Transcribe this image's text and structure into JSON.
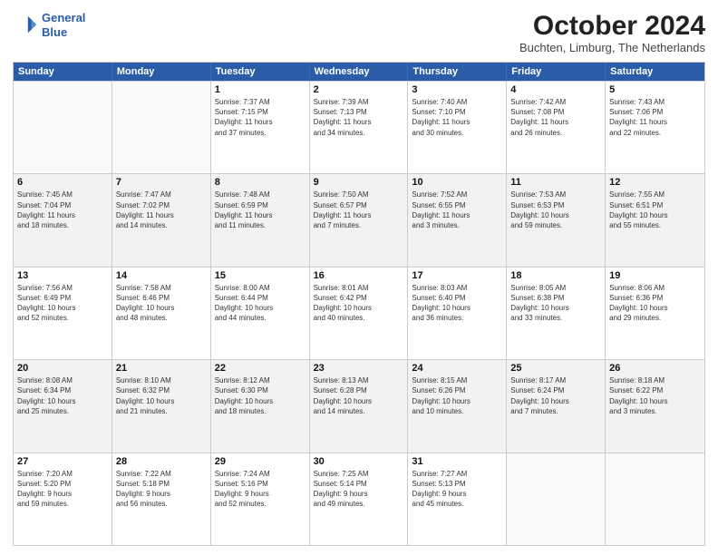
{
  "logo": {
    "line1": "General",
    "line2": "Blue"
  },
  "title": "October 2024",
  "subtitle": "Buchten, Limburg, The Netherlands",
  "days_of_week": [
    "Sunday",
    "Monday",
    "Tuesday",
    "Wednesday",
    "Thursday",
    "Friday",
    "Saturday"
  ],
  "weeks": [
    [
      {
        "day": "",
        "info": "",
        "empty": true
      },
      {
        "day": "",
        "info": "",
        "empty": true
      },
      {
        "day": "1",
        "info": "Sunrise: 7:37 AM\nSunset: 7:15 PM\nDaylight: 11 hours\nand 37 minutes.",
        "empty": false
      },
      {
        "day": "2",
        "info": "Sunrise: 7:39 AM\nSunset: 7:13 PM\nDaylight: 11 hours\nand 34 minutes.",
        "empty": false
      },
      {
        "day": "3",
        "info": "Sunrise: 7:40 AM\nSunset: 7:10 PM\nDaylight: 11 hours\nand 30 minutes.",
        "empty": false
      },
      {
        "day": "4",
        "info": "Sunrise: 7:42 AM\nSunset: 7:08 PM\nDaylight: 11 hours\nand 26 minutes.",
        "empty": false
      },
      {
        "day": "5",
        "info": "Sunrise: 7:43 AM\nSunset: 7:06 PM\nDaylight: 11 hours\nand 22 minutes.",
        "empty": false
      }
    ],
    [
      {
        "day": "6",
        "info": "Sunrise: 7:45 AM\nSunset: 7:04 PM\nDaylight: 11 hours\nand 18 minutes.",
        "empty": false
      },
      {
        "day": "7",
        "info": "Sunrise: 7:47 AM\nSunset: 7:02 PM\nDaylight: 11 hours\nand 14 minutes.",
        "empty": false
      },
      {
        "day": "8",
        "info": "Sunrise: 7:48 AM\nSunset: 6:59 PM\nDaylight: 11 hours\nand 11 minutes.",
        "empty": false
      },
      {
        "day": "9",
        "info": "Sunrise: 7:50 AM\nSunset: 6:57 PM\nDaylight: 11 hours\nand 7 minutes.",
        "empty": false
      },
      {
        "day": "10",
        "info": "Sunrise: 7:52 AM\nSunset: 6:55 PM\nDaylight: 11 hours\nand 3 minutes.",
        "empty": false
      },
      {
        "day": "11",
        "info": "Sunrise: 7:53 AM\nSunset: 6:53 PM\nDaylight: 10 hours\nand 59 minutes.",
        "empty": false
      },
      {
        "day": "12",
        "info": "Sunrise: 7:55 AM\nSunset: 6:51 PM\nDaylight: 10 hours\nand 55 minutes.",
        "empty": false
      }
    ],
    [
      {
        "day": "13",
        "info": "Sunrise: 7:56 AM\nSunset: 6:49 PM\nDaylight: 10 hours\nand 52 minutes.",
        "empty": false
      },
      {
        "day": "14",
        "info": "Sunrise: 7:58 AM\nSunset: 6:46 PM\nDaylight: 10 hours\nand 48 minutes.",
        "empty": false
      },
      {
        "day": "15",
        "info": "Sunrise: 8:00 AM\nSunset: 6:44 PM\nDaylight: 10 hours\nand 44 minutes.",
        "empty": false
      },
      {
        "day": "16",
        "info": "Sunrise: 8:01 AM\nSunset: 6:42 PM\nDaylight: 10 hours\nand 40 minutes.",
        "empty": false
      },
      {
        "day": "17",
        "info": "Sunrise: 8:03 AM\nSunset: 6:40 PM\nDaylight: 10 hours\nand 36 minutes.",
        "empty": false
      },
      {
        "day": "18",
        "info": "Sunrise: 8:05 AM\nSunset: 6:38 PM\nDaylight: 10 hours\nand 33 minutes.",
        "empty": false
      },
      {
        "day": "19",
        "info": "Sunrise: 8:06 AM\nSunset: 6:36 PM\nDaylight: 10 hours\nand 29 minutes.",
        "empty": false
      }
    ],
    [
      {
        "day": "20",
        "info": "Sunrise: 8:08 AM\nSunset: 6:34 PM\nDaylight: 10 hours\nand 25 minutes.",
        "empty": false
      },
      {
        "day": "21",
        "info": "Sunrise: 8:10 AM\nSunset: 6:32 PM\nDaylight: 10 hours\nand 21 minutes.",
        "empty": false
      },
      {
        "day": "22",
        "info": "Sunrise: 8:12 AM\nSunset: 6:30 PM\nDaylight: 10 hours\nand 18 minutes.",
        "empty": false
      },
      {
        "day": "23",
        "info": "Sunrise: 8:13 AM\nSunset: 6:28 PM\nDaylight: 10 hours\nand 14 minutes.",
        "empty": false
      },
      {
        "day": "24",
        "info": "Sunrise: 8:15 AM\nSunset: 6:26 PM\nDaylight: 10 hours\nand 10 minutes.",
        "empty": false
      },
      {
        "day": "25",
        "info": "Sunrise: 8:17 AM\nSunset: 6:24 PM\nDaylight: 10 hours\nand 7 minutes.",
        "empty": false
      },
      {
        "day": "26",
        "info": "Sunrise: 8:18 AM\nSunset: 6:22 PM\nDaylight: 10 hours\nand 3 minutes.",
        "empty": false
      }
    ],
    [
      {
        "day": "27",
        "info": "Sunrise: 7:20 AM\nSunset: 5:20 PM\nDaylight: 9 hours\nand 59 minutes.",
        "empty": false
      },
      {
        "day": "28",
        "info": "Sunrise: 7:22 AM\nSunset: 5:18 PM\nDaylight: 9 hours\nand 56 minutes.",
        "empty": false
      },
      {
        "day": "29",
        "info": "Sunrise: 7:24 AM\nSunset: 5:16 PM\nDaylight: 9 hours\nand 52 minutes.",
        "empty": false
      },
      {
        "day": "30",
        "info": "Sunrise: 7:25 AM\nSunset: 5:14 PM\nDaylight: 9 hours\nand 49 minutes.",
        "empty": false
      },
      {
        "day": "31",
        "info": "Sunrise: 7:27 AM\nSunset: 5:13 PM\nDaylight: 9 hours\nand 45 minutes.",
        "empty": false
      },
      {
        "day": "",
        "info": "",
        "empty": true
      },
      {
        "day": "",
        "info": "",
        "empty": true
      }
    ]
  ]
}
